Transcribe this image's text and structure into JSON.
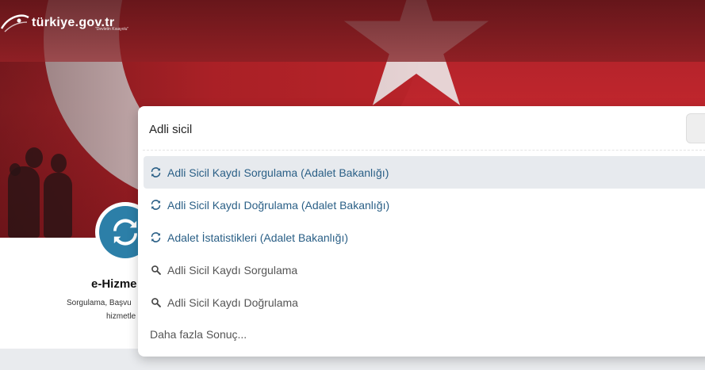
{
  "header": {
    "logo_text": "türkiye.gov.tr",
    "logo_subtext": "\"Devletin Kısayolu\""
  },
  "search": {
    "value": "Adli sicil",
    "results": [
      {
        "label": "Adli Sicil Kaydı Sorgulama (Adalet Bakanlığı)",
        "type": "service",
        "icon": "refresh-icon",
        "active": true
      },
      {
        "label": "Adli Sicil Kaydı Doğrulama (Adalet Bakanlığı)",
        "type": "service",
        "icon": "refresh-icon",
        "active": false
      },
      {
        "label": "Adalet İstatistikleri (Adalet Bakanlığı)",
        "type": "service",
        "icon": "refresh-icon",
        "active": false
      },
      {
        "label": "Adli Sicil Kaydı Sorgulama",
        "type": "query",
        "icon": "search-icon",
        "active": false
      },
      {
        "label": "Adli Sicil Kaydı Doğrulama",
        "type": "query",
        "icon": "search-icon",
        "active": false
      }
    ],
    "more_label": "Daha fazla Sonuç..."
  },
  "card": {
    "title": "e-Hizme",
    "description_line1": "Sorgulama, Başvu",
    "description_line2": "hizmetle"
  },
  "colors": {
    "service_link": "#2a5f86",
    "query_text": "#555555",
    "active_row": "#e7eaee",
    "card_icon": "#2c7fa8",
    "flag_red": "#c0262d"
  }
}
